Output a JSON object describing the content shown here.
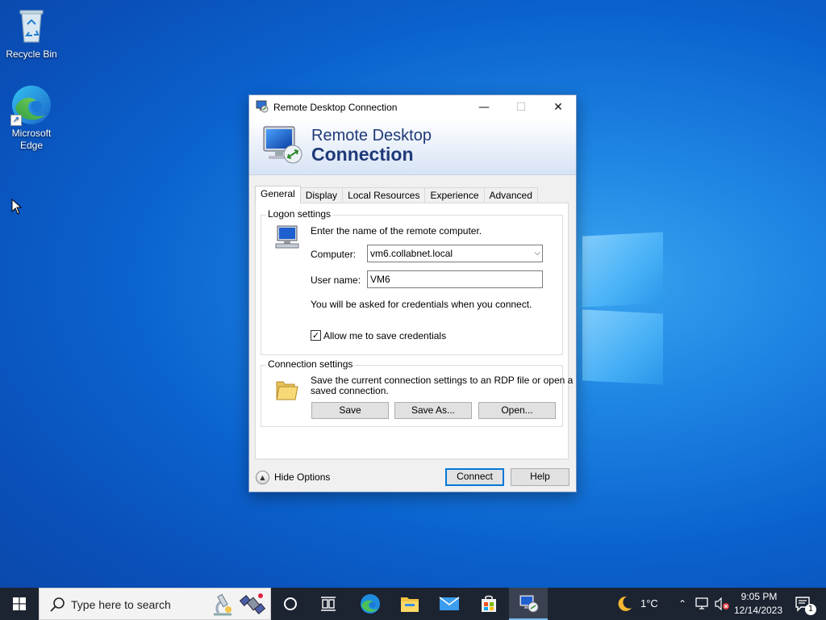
{
  "desktop": {
    "icons": [
      {
        "label": "Recycle Bin",
        "icon": "recycle-bin-icon"
      },
      {
        "label": "Microsoft Edge",
        "icon": "edge-icon"
      }
    ]
  },
  "dialog": {
    "title": "Remote Desktop Connection",
    "banner_line1": "Remote Desktop",
    "banner_line2": "Connection",
    "tabs": [
      "General",
      "Display",
      "Local Resources",
      "Experience",
      "Advanced"
    ],
    "active_tab": "General",
    "logon": {
      "legend": "Logon settings",
      "instruction": "Enter the name of the remote computer.",
      "computer_label": "Computer:",
      "computer_value": "vm6.collabnet.local",
      "username_label": "User name:",
      "username_value": "VM6",
      "credentials_note": "You will be asked for credentials when you connect.",
      "save_credentials_label": "Allow me to save credentials",
      "save_credentials_checked": true
    },
    "connection": {
      "legend": "Connection settings",
      "description_line1": "Save the current connection settings to an RDP file or open a",
      "description_line2": "saved connection.",
      "save_label": "Save",
      "save_as_label": "Save As...",
      "open_label": "Open..."
    },
    "hide_options_label": "Hide Options",
    "connect_label": "Connect",
    "help_label": "Help"
  },
  "taskbar": {
    "search_placeholder": "Type here to search",
    "temperature": "1°C",
    "time": "9:05 PM",
    "date": "12/14/2023",
    "notification_count": "1"
  },
  "colors": {
    "accent": "#0078d7",
    "banner_text": "#1f3a78",
    "taskbar": "#1c2331"
  }
}
